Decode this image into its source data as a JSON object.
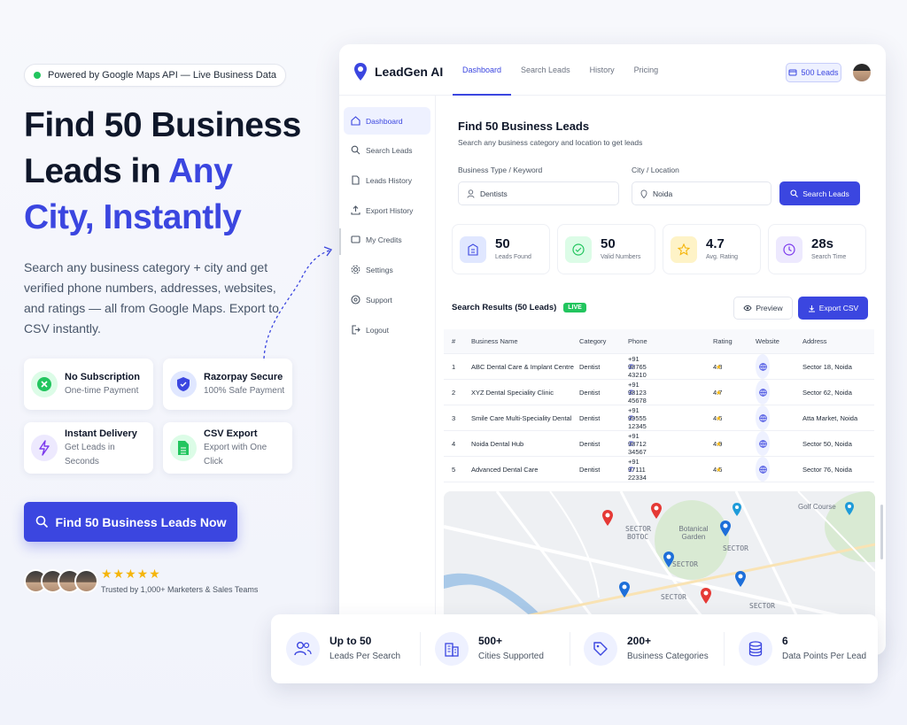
{
  "hero": {
    "pill": "Powered by Google Maps API — Live Business Data",
    "title_line1": "Find 50 Business",
    "title_line2_plain": "Leads in ",
    "title_line2_accent": "Any",
    "title_line3": "City, Instantly",
    "description": "Search any business category + city and get verified phone numbers, addresses, websites, and ratings — all from Google Maps. Export to CSV instantly.",
    "features": [
      {
        "title": "No Subscription",
        "subtitle": "One-time Payment"
      },
      {
        "title": "Razorpay Secure",
        "subtitle": "100% Safe Payment"
      },
      {
        "title": "Instant Delivery",
        "subtitle": "Get Leads in Seconds"
      },
      {
        "title": "CSV Export",
        "subtitle": "Export with One Click"
      }
    ],
    "cta": "Find 50 Business Leads Now",
    "stars": "★★★★★",
    "trust": "Trusted by 1,000+ Marketers & Sales Teams"
  },
  "app": {
    "logo": "LeadGen AI",
    "nav": [
      "Dashboard",
      "Search Leads",
      "History",
      "Pricing"
    ],
    "active_nav": "Dashboard",
    "leads_badge": "500 Leads",
    "sidebar": [
      {
        "label": "Dashboard",
        "icon": "home-icon"
      },
      {
        "label": "Search Leads",
        "icon": "search-icon"
      },
      {
        "label": "Leads History",
        "icon": "document-icon"
      },
      {
        "label": "Export History",
        "icon": "export-icon"
      },
      {
        "label": "My Credits",
        "icon": "credits-icon"
      },
      {
        "label": "Settings",
        "icon": "gear-icon"
      },
      {
        "label": "Support",
        "icon": "help-icon"
      },
      {
        "label": "Logout",
        "icon": "logout-icon"
      }
    ],
    "search_panel": {
      "title": "Find 50 Business Leads",
      "subtitle": "Search any business category and location to get leads",
      "type_label": "Business Type / Keyword",
      "type_value": "Dentists",
      "city_label": "City / Location",
      "city_value": "Noida",
      "button": "Search Leads"
    },
    "stats": [
      {
        "value": "50",
        "label": "Leads Found"
      },
      {
        "value": "50",
        "label": "Valid Numbers"
      },
      {
        "value": "4.7",
        "label": "Avg. Rating"
      },
      {
        "value": "28s",
        "label": "Search Time"
      }
    ],
    "results": {
      "title": "Search Results (50 Leads)",
      "live": "LIVE",
      "preview": "Preview",
      "export": "Export CSV",
      "columns": [
        "#",
        "Business Name",
        "Category",
        "Phone",
        "Rating",
        "Website",
        "Address"
      ],
      "rows": [
        {
          "num": "1",
          "name": "ABC Dental Care & Implant Centre",
          "category": "Dentist",
          "phone": "+91 98765 43210",
          "rating": "4.8",
          "address": "Sector 18, Noida"
        },
        {
          "num": "2",
          "name": "XYZ Dental Speciality Clinic",
          "category": "Dentist",
          "phone": "+91 98123 45678",
          "rating": "4.7",
          "address": "Sector 62, Noida"
        },
        {
          "num": "3",
          "name": "Smile Care Multi-Speciality Dental",
          "category": "Dentist",
          "phone": "+91 99555 12345",
          "rating": "4.6",
          "address": "Atta Market, Noida"
        },
        {
          "num": "4",
          "name": "Noida Dental Hub",
          "category": "Dentist",
          "phone": "+91 98712 34567",
          "rating": "4.9",
          "address": "Sector 50, Noida"
        },
        {
          "num": "5",
          "name": "Advanced Dental Care",
          "category": "Dentist",
          "phone": "+91 97111 22334",
          "rating": "4.5",
          "address": "Sector 76, Noida"
        }
      ]
    },
    "map": {
      "labels": [
        "SECTOR",
        "BOTOC",
        "Botanical Garden",
        "SECTOR",
        "Golf Course",
        "SECTOR",
        "SECTOR",
        "SECTOR"
      ]
    }
  },
  "bottom_stats": [
    {
      "value": "Up to 50",
      "label": "Leads Per Search",
      "icon": "users-icon"
    },
    {
      "value": "500+",
      "label": "Cities Supported",
      "icon": "building-icon"
    },
    {
      "value": "200+",
      "label": "Business Categories",
      "icon": "tag-icon"
    },
    {
      "value": "6",
      "label": "Data Points Per Lead",
      "icon": "database-icon"
    }
  ],
  "colors": {
    "accent": "#3b46e0",
    "live": "#22c55e",
    "star": "#f5b50a"
  }
}
